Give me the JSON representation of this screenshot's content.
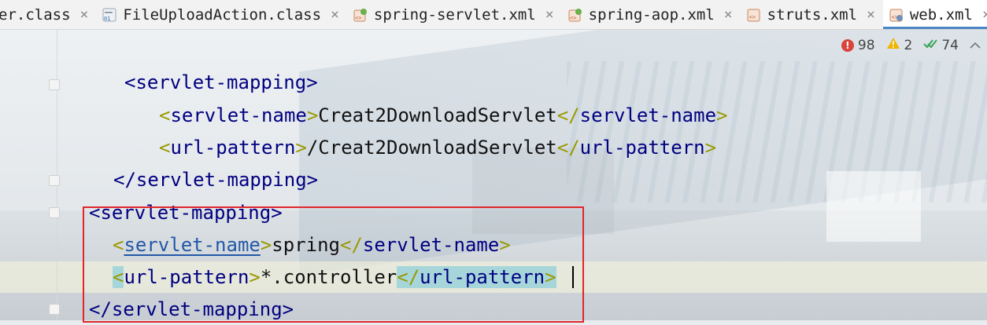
{
  "tabs": [
    {
      "label": "er.class",
      "icon": "class-file-icon",
      "active": false
    },
    {
      "label": "FileUploadAction.class",
      "icon": "class-file-icon",
      "active": false
    },
    {
      "label": "spring-servlet.xml",
      "icon": "spring-xml-icon",
      "active": false
    },
    {
      "label": "spring-aop.xml",
      "icon": "spring-xml-icon",
      "active": false
    },
    {
      "label": "struts.xml",
      "icon": "xml-file-icon",
      "active": false
    },
    {
      "label": "web.xml",
      "icon": "web-xml-icon",
      "active": true
    }
  ],
  "close_glyph": "×",
  "inspections": {
    "errors": "98",
    "warnings": "2",
    "weak_warnings": "74"
  },
  "code": {
    "line1": {
      "open": "<",
      "tag": "servlet-mapping",
      "close": ">"
    },
    "line2": {
      "open": "<",
      "tag": "servlet-name",
      "close": ">",
      "text": "Creat2DownloadServlet",
      "open2": "</",
      "tag2": "servlet-name",
      "close2": ">"
    },
    "line3": {
      "open": "<",
      "tag": "url-pattern",
      "close": ">",
      "text": "/Creat2DownloadServlet",
      "open2": "</",
      "tag2": "url-pattern",
      "close2": ">"
    },
    "line4": {
      "open": "</",
      "tag": "servlet-mapping",
      "close": ">"
    },
    "line5": {
      "open": "<",
      "tag": "servlet-mapping",
      "close": ">"
    },
    "line6": {
      "open": "<",
      "tag": "servlet-name",
      "close": ">",
      "text": "spring",
      "open2": "</",
      "tag2": "servlet-name",
      "close2": ">"
    },
    "line7": {
      "open": "<",
      "tag": "url-pattern",
      "close": ">",
      "text": "*.controller",
      "open2": "</",
      "tag2": "url-pattern",
      "close2": ">"
    },
    "line8": {
      "open": "</",
      "tag": "servlet-mapping",
      "close": ">"
    }
  },
  "colors": {
    "tag": "#000080",
    "bracket": "#999900",
    "highlight": "#a6d6d9",
    "annotation_box": "#e0262b",
    "active_tab_underline": "#4a86c8"
  }
}
